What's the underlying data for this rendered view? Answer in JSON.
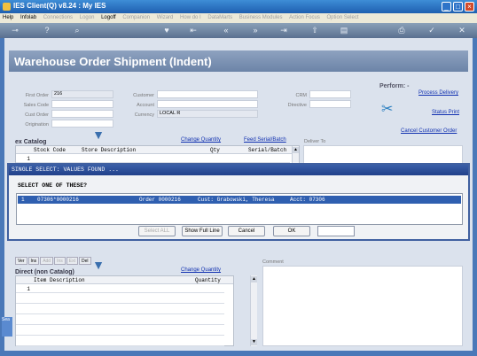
{
  "window": {
    "title": "IES Client(Q) v8.24 : My IES",
    "btn_min": "_",
    "btn_max": "□",
    "btn_close": "×"
  },
  "menu": [
    {
      "label": "Help",
      "enabled": true
    },
    {
      "label": "Infolab",
      "enabled": true
    },
    {
      "label": "Connections",
      "enabled": false
    },
    {
      "label": "Logon",
      "enabled": false
    },
    {
      "label": "Logoff",
      "enabled": true
    },
    {
      "label": "Companion",
      "enabled": false
    },
    {
      "label": "Wizard",
      "enabled": false
    },
    {
      "label": "How do I",
      "enabled": false
    },
    {
      "label": "DataMarts",
      "enabled": false
    },
    {
      "label": "Business Modules",
      "enabled": false
    },
    {
      "label": "Action Focus",
      "enabled": false
    },
    {
      "label": "Option Select",
      "enabled": false
    }
  ],
  "toolbar_icons": [
    "key-icon",
    "help-icon",
    "search-icon",
    "heart-icon",
    "first-icon",
    "prev-icon",
    "next-icon",
    "last-icon",
    "upload-icon",
    "clipboard-icon",
    "print-icon",
    "ok-icon",
    "close-icon"
  ],
  "page": {
    "title": "Warehouse Order Shipment (Indent)"
  },
  "form": {
    "first_order_label": "First Order",
    "first_order_value": "216",
    "sales_code_label": "Sales Code",
    "cust_order_label": "Cust Order",
    "origination_label": "Origination",
    "customer_label": "Customer",
    "account_label": "Account",
    "currency_label": "Currency",
    "currency_value": "LOCAL R",
    "crm_label": "CRM",
    "directive_label": "Directive"
  },
  "perform": {
    "title": "Perform: -",
    "process_delivery": "Process Delivery",
    "status_print": "Status Print",
    "cancel_customer_order": "Cancel Customer Order"
  },
  "catalog": {
    "title": "ex Catalog",
    "change_quantity": "Change Quantity",
    "feed_serial": "Feed Serial/Batch",
    "deliver_to": "Deliver To",
    "columns": [
      "Stock Code",
      "Store Description",
      "Qty",
      "Serial/Batch"
    ],
    "row_num": "1"
  },
  "dialog": {
    "title": "SINGLE SELECT: VALUES FOUND ...",
    "prompt": "SELECT ONE OF THESE?",
    "row": {
      "num": "1",
      "key": "07306*0000216",
      "order": "Order 0000216",
      "cust": "Cust: Grabowski, Theresa",
      "acct": "Acct: 07306"
    },
    "buttons": {
      "select_all": "Select ALL",
      "show_full_line": "Show Full Line",
      "cancel": "Cancel",
      "ok": "OK"
    }
  },
  "tabs": [
    {
      "label": "Ver",
      "enabled": true
    },
    {
      "label": "Ins",
      "enabled": true
    },
    {
      "label": "Add",
      "enabled": false
    },
    {
      "label": "Ins",
      "enabled": false
    },
    {
      "label": "Ext",
      "enabled": false
    },
    {
      "label": "Del",
      "enabled": true
    }
  ],
  "direct": {
    "title": "Direct (non Catalog)",
    "change_quantity": "Change Quantity",
    "comment": "Comment",
    "columns": [
      "Item Description",
      "Quantity"
    ],
    "row_num": "1"
  },
  "side_tab": "Sea"
}
